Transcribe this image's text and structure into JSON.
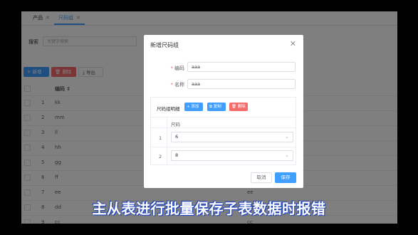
{
  "tabs": [
    {
      "label": "产品"
    },
    {
      "label": "尺码组"
    }
  ],
  "search": {
    "label": "搜索",
    "placeholder": "关键字搜索"
  },
  "toolbar": {
    "add_label": "+ 新增",
    "delete_label": "删除",
    "export_label": "导出"
  },
  "table": {
    "col_code_header": "编码 ⇕",
    "rows": [
      {
        "index": "1",
        "code": "kk",
        "name": ""
      },
      {
        "index": "2",
        "code": "mm",
        "name": ""
      },
      {
        "index": "3",
        "code": "ll",
        "name": ""
      },
      {
        "index": "4",
        "code": "hh",
        "name": ""
      },
      {
        "index": "5",
        "code": "gg",
        "name": ""
      },
      {
        "index": "6",
        "code": "ff",
        "name": ""
      },
      {
        "index": "7",
        "code": "ee",
        "name": "ee"
      },
      {
        "index": "8",
        "code": "dd",
        "name": "dd"
      },
      {
        "index": "9",
        "code": "cc",
        "name": "cc"
      }
    ]
  },
  "dialog": {
    "title": "新增尺码组",
    "code_label": "编码",
    "code_value": "aaa",
    "name_label": "名称",
    "name_value": "aaa",
    "detail_title": "尺码组明细",
    "detail_add": "+ 添加",
    "detail_copy": "复制",
    "detail_delete": "删除",
    "detail_col": "尺码",
    "detail_rows": [
      {
        "index": "1",
        "value": "6"
      },
      {
        "index": "2",
        "value": "8"
      }
    ],
    "cancel_label": "取消",
    "save_label": "保存"
  },
  "subtitle": "主从表进行批量保存子表数据时报错",
  "colors": {
    "primary": "#409eff",
    "danger": "#f56c6c"
  }
}
